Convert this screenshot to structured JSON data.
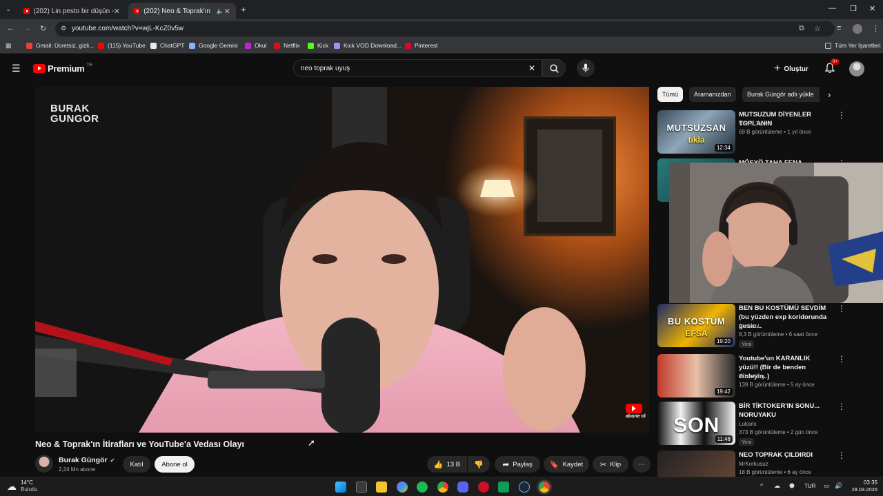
{
  "browser": {
    "tabs": [
      {
        "title": "(202) Lin pesto bir düşün - You",
        "active": false
      },
      {
        "title": "(202) Neo & Toprak'ın İtirafl",
        "active": true
      }
    ],
    "url": "youtube.com/watch?v=wjL-KcZ0v5w",
    "bookmarks": [
      {
        "label": "Gmail: Ücretsiz, gizli...",
        "color": "#ea4335"
      },
      {
        "label": "(115) YouTube",
        "color": "#ff0000"
      },
      {
        "label": "ChatGPT",
        "color": "#e8eaed"
      },
      {
        "label": "Google Gemini",
        "color": "#8ab4f8"
      },
      {
        "label": "Okul",
        "color": "#c026d3"
      },
      {
        "label": "Netflix",
        "color": "#e50914"
      },
      {
        "label": "Kick",
        "color": "#53fc18"
      },
      {
        "label": "Kick VOD Download...",
        "color": "#a78bfa"
      },
      {
        "label": "Pinterest",
        "color": "#e60023"
      }
    ],
    "all_bookmarks": "Tüm Yer İşaretleri"
  },
  "youtube": {
    "logo_text": "Premium",
    "logo_region": "TR",
    "search_query": "neo toprak uyuş",
    "create_label": "Oluştur",
    "notifications_badge": "9+"
  },
  "video": {
    "title": "Neo & Toprak'ın İtirafları ve YouTube'a Vedası Olayı",
    "watermark_line1": "BURAK",
    "watermark_line2": "GUNGOR",
    "subscribe_overlay": "abone ol",
    "channel_name": "Burak Güngör",
    "subscribers": "2,24 Mn abone",
    "join_label": "Katıl",
    "subscribe_label": "Abone ol",
    "likes": "13 B",
    "share_label": "Paylaş",
    "save_label": "Kaydet",
    "clip_label": "Klip"
  },
  "chips": [
    "Tümü",
    "Aramanızdan",
    "Burak Güngör adlı yükle"
  ],
  "recommendations": [
    {
      "title": "MUTSUZUM DİYENLER TOPLANIN",
      "channel": "Neo & Toprak",
      "meta": "69 B görüntüleme • 1 yıl önce",
      "duration": "12:34",
      "thumb_text": "MUTSUZSAN",
      "thumb_text2": "tıkla",
      "new": ""
    },
    {
      "title": "MÖSYÖ TAHA FENA",
      "channel": "",
      "meta": "",
      "duration": "",
      "thumb_text": "",
      "new": ""
    },
    {
      "title": "BEN BU KOSTÜMÜ SEVDİM (bu yüzden exp koridorunda gusio...",
      "channel": "PorkatoL",
      "meta": "8,3 B görüntüleme • 6 saat önce",
      "duration": "19:20",
      "thumb_text": "BU KOSTÜM",
      "thumb_text2": "EFSA",
      "new": "Yeni"
    },
    {
      "title": "Youtube'un KARANLIK yüzü!! (Bir de benden dinleyin..)",
      "channel": "Takla King",
      "meta": "139 B görüntüleme • 5 ay önce",
      "duration": "19:42",
      "thumb_text": "",
      "new": ""
    },
    {
      "title": "BİR TİKTOKER'IN SONU... NORUYAKU",
      "channel": "Lukarix",
      "meta": "373 B görüntüleme • 2 gün önce",
      "duration": "11:48",
      "thumb_text": "SON",
      "new": "Yeni"
    },
    {
      "title": "NEO TOPRAK ÇILDIRDI",
      "channel": "MrKorkusuz",
      "meta": "18 B görüntüleme • 6 ay önce",
      "duration": "",
      "thumb_text": "",
      "new": ""
    }
  ],
  "taskbar": {
    "weather_temp": "14°C",
    "weather_desc": "Bulutlu",
    "lang": "TUR",
    "time": "03:35",
    "date": "28.03.2026"
  },
  "colors": {
    "youtube_red": "#ff0000",
    "bg": "#0f0f0f",
    "chip_bg": "#272727"
  }
}
